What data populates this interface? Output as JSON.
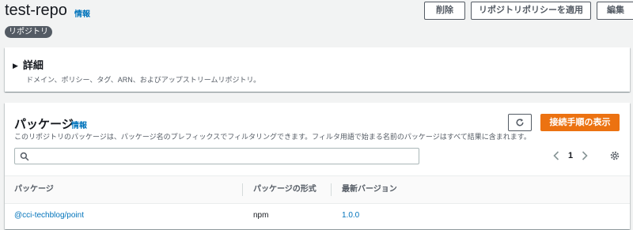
{
  "header": {
    "title": "test-repo",
    "info_label": "情報",
    "badge": "リポジトリ",
    "buttons": {
      "delete": "削除",
      "apply_policy": "リポジトリポリシーを適用",
      "edit": "編集"
    }
  },
  "details": {
    "title": "詳細",
    "description": "ドメイン、ポリシー、タグ、ARN、およびアップストリームリポジトリ。"
  },
  "packages": {
    "title": "パッケージ",
    "info_label": "情報",
    "description": "このリポジトリのパッケージは、パッケージ名のプレフィックスでフィルタリングできます。フィルタ用語で始まる名前のパッケージはすべて結果に含まれます。",
    "connect_button": "接続手順の表示",
    "search": {
      "value": "",
      "placeholder": ""
    },
    "pagination": {
      "current_page": "1"
    },
    "columns": [
      "パッケージ",
      "パッケージの形式",
      "最新バージョン"
    ],
    "rows": [
      {
        "package": "@cci-techblog/point",
        "format": "npm",
        "latest_version": "1.0.0"
      }
    ]
  },
  "colors": {
    "primary": "#ec7211",
    "link": "#0073bb",
    "badge_bg": "#545b64"
  },
  "icons": [
    "refresh-icon",
    "search-icon",
    "chevron-left-icon",
    "chevron-right-icon",
    "gear-icon",
    "caret-right-icon"
  ]
}
